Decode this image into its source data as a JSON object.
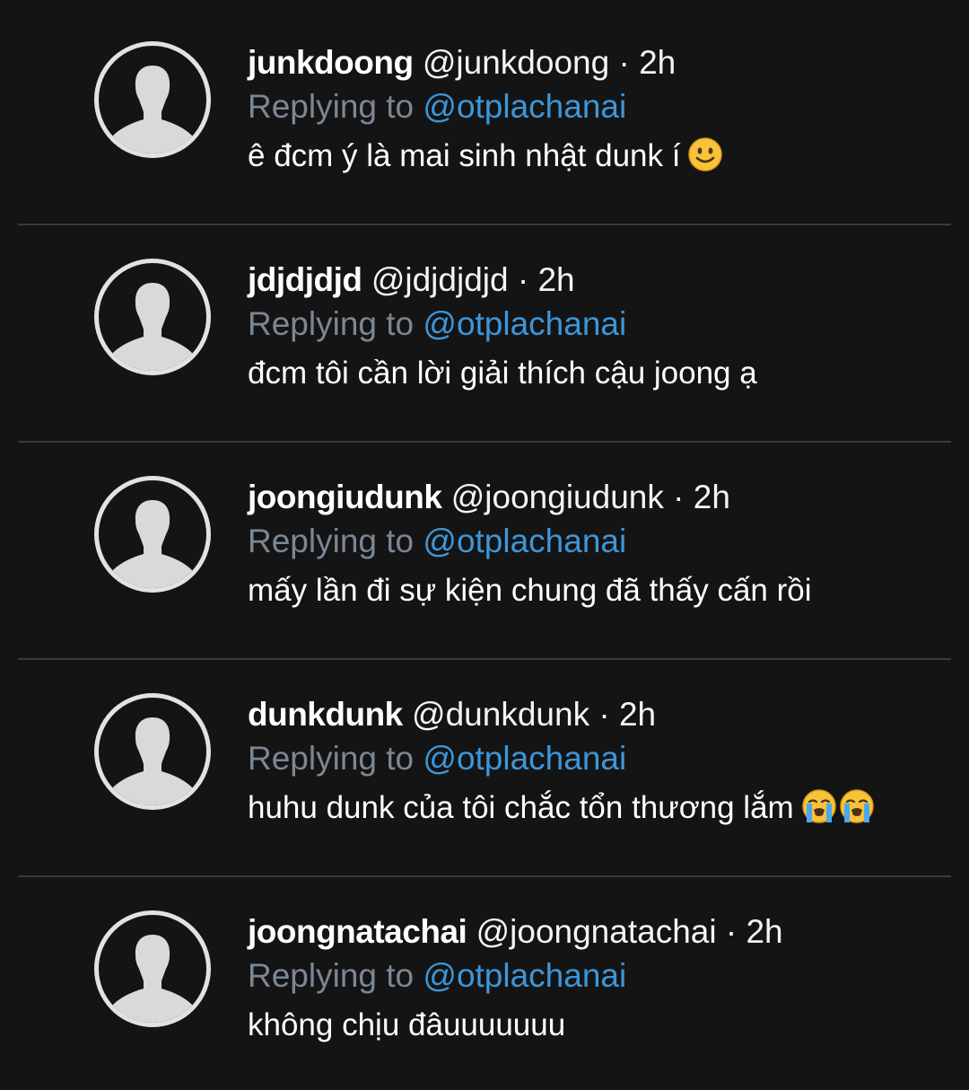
{
  "colors": {
    "background": "#141414",
    "divider": "#3a3a3a",
    "muted_text": "#7c8794",
    "mention": "#3d96d8",
    "avatar_ring": "#e2e2e2"
  },
  "replies": [
    {
      "display_name": "junkdoong",
      "handle": "@junkdoong",
      "dot": "·",
      "time": "2h",
      "replying_label": "Replying to",
      "reply_to": "@otplachanai",
      "text": "ê đcm ý là mai sinh nhật dunk í",
      "emojis": [
        "slightly-smiling-face-emoji"
      ]
    },
    {
      "display_name": "jdjdjdjd",
      "handle": "@jdjdjdjd",
      "dot": "·",
      "time": "2h",
      "replying_label": "Replying to",
      "reply_to": "@otplachanai",
      "text": "đcm tôi cần lời giải thích cậu joong ạ",
      "emojis": []
    },
    {
      "display_name": "joongiudunk",
      "handle": "@joongiudunk",
      "dot": "·",
      "time": "2h",
      "replying_label": "Replying to",
      "reply_to": "@otplachanai",
      "text": "mấy lần đi sự kiện chung đã thấy cấn rồi",
      "emojis": []
    },
    {
      "display_name": "dunkdunk",
      "handle": "@dunkdunk",
      "dot": "·",
      "time": "2h",
      "replying_label": "Replying to",
      "reply_to": "@otplachanai",
      "text": "huhu dunk của tôi chắc tổn thương lắm",
      "emojis": [
        "loudly-crying-face-emoji",
        "loudly-crying-face-emoji"
      ]
    },
    {
      "display_name": "joongnatachai",
      "handle": "@joongnatachai",
      "dot": "·",
      "time": "2h",
      "replying_label": "Replying to",
      "reply_to": "@otplachanai",
      "text": "không chịu đâuuuuuuu",
      "emojis": []
    }
  ]
}
